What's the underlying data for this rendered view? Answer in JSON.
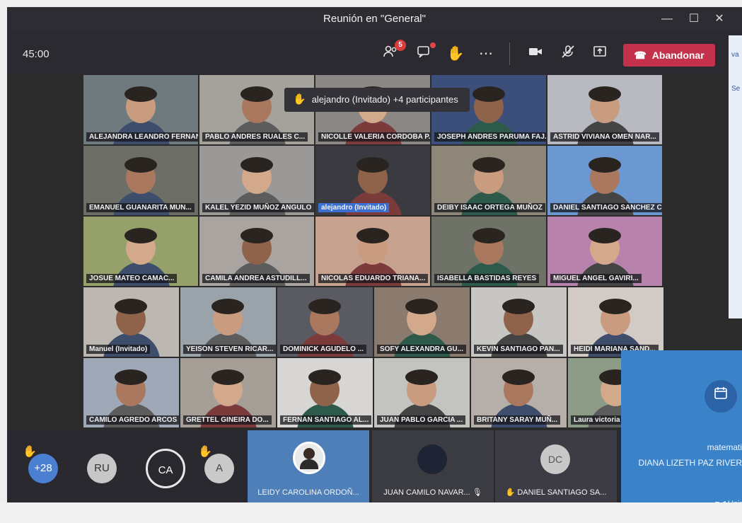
{
  "window": {
    "title": "Reunión en \"General\"",
    "minimize_icon": "minimize-icon",
    "maximize_icon": "maximize-icon",
    "close_icon": "close-icon"
  },
  "toolbar": {
    "timer": "45:00",
    "participants_badge": "5",
    "leave_label": "Abandonar",
    "icons": [
      "participants-icon",
      "chat-icon",
      "raise-hand-icon",
      "more-options-icon",
      "camera-icon",
      "mic-off-icon",
      "share-screen-icon",
      "phone-hangup-icon"
    ]
  },
  "side_strip": {
    "text_1": "va",
    "text_2": "Se"
  },
  "hand_notification": {
    "text": "alejandro (Invitado) +4 participantes"
  },
  "participants": [
    {
      "name": "ALEJANDRA LEANDRO FERNANDEZ...",
      "bg": "#6f7a7e"
    },
    {
      "name": "PABLO ANDRES RUALES C...",
      "bg": "#a5a29b"
    },
    {
      "name": "NICOLLE VALERIA CORDOBA P...",
      "bg": "#8a8784"
    },
    {
      "name": "JOSEPH ANDRES PARUMA FAJ...",
      "bg": "#3c4f7a"
    },
    {
      "name": "ASTRID VIVIANA OMEN NAR...",
      "bg": "#b9b9c2"
    },
    {
      "name": "EMANUEL GUANARITA MUN...",
      "bg": "#6d6f66"
    },
    {
      "name": "KALEL YEZID MUÑOZ ANGULO",
      "bg": "#9a9997"
    },
    {
      "name": "alejandro (Invitado)",
      "bg": "#3b3a40"
    },
    {
      "name": "DEIBY ISAAC ORTEGA MUÑOZ",
      "bg": "#8d8679"
    },
    {
      "name": "DANIEL SANTIAGO SANCHEZ C...",
      "bg": "#6c98d1"
    },
    {
      "name": "JOSUE MATEO CAMAC...",
      "bg": "#96a06a"
    },
    {
      "name": "CAMILA ANDREA ASTUDILL...",
      "bg": "#a9a4a0"
    },
    {
      "name": "NICOLAS EDUARDO TRIANA...",
      "bg": "#c7a38f"
    },
    {
      "name": "ISABELLA BASTIDAS REYES",
      "bg": "#6f7367"
    },
    {
      "name": "MIGUEL ANGEL GAVIRI...",
      "bg": "#b783ac"
    },
    {
      "name": "Manuel (Invitado)",
      "bg": "#bdb7b2"
    },
    {
      "name": "YEISON STEVEN RICAR...",
      "bg": "#9aa3aa"
    },
    {
      "name": "DOMINICK AGUDELO ...",
      "bg": "#5a5a62"
    },
    {
      "name": "SOFY ALEXANDRA GU...",
      "bg": "#8b7b6e"
    },
    {
      "name": "KEVIN SANTIAGO PAN...",
      "bg": "#c8c6c3"
    },
    {
      "name": "HEIDI MARIANA SAND...",
      "bg": "#d2cbc5"
    },
    {
      "name": "CAMILO AGREDO ARCOS",
      "bg": "#9ea8b7"
    },
    {
      "name": "GRETTEL GINEIRA DO...",
      "bg": "#a59e97"
    },
    {
      "name": "FERNAN SANTIAGO AL...",
      "bg": "#d7d6d4"
    },
    {
      "name": "JUAN PABLO GARCIA ...",
      "bg": "#c3c3c0"
    },
    {
      "name": "BRITANY SARAY MUÑ...",
      "bg": "#b6afa9"
    },
    {
      "name": "Laura victoria maca...",
      "bg": "#8c9b86"
    }
  ],
  "bottom_row": {
    "overflow_count": "+28",
    "avatars": [
      {
        "initials": "RU",
        "color": "#c7c7c7",
        "text": "#333"
      },
      {
        "initials": "CA",
        "color": "#b9b9b9",
        "text": "#fff"
      },
      {
        "initials": "A",
        "color": "#c9c9c9",
        "text": "#444"
      }
    ],
    "tiles": [
      {
        "name": "LEIDY CAROLINA ORDOÑ..."
      },
      {
        "name": "JUAN CAMILO NAVAR..."
      },
      {
        "name": "DANIEL SANTIAGO SA...",
        "initials": "DC"
      }
    ]
  },
  "pinned": {
    "title": "matemati",
    "organizer": "DIANA LIZETH PAZ RIVER",
    "join_label": "Unir",
    "icon": "calendar-icon"
  },
  "colors": {
    "leave": "#c4314b",
    "hand": "#f5c518",
    "accent": "#3b83c8"
  }
}
